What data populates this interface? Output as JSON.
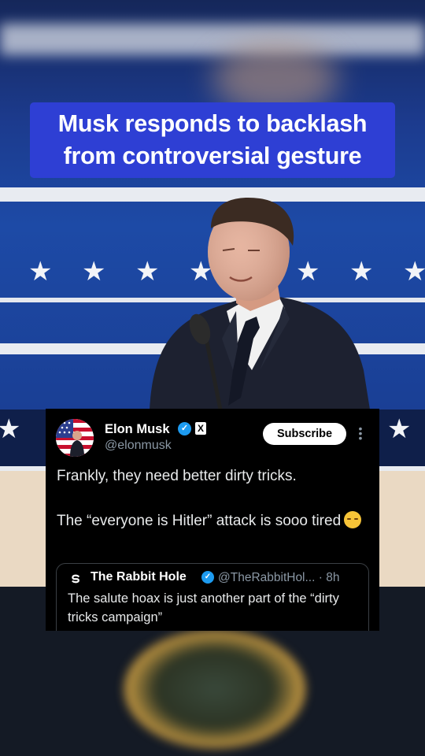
{
  "headline": {
    "line1": "Musk responds to backlash",
    "line2": "from controversial gesture"
  },
  "tweet": {
    "author_name": "Elon Musk",
    "author_handle": "@elonmusk",
    "subscribe_label": "Subscribe",
    "text_line1": "Frankly, they need better dirty tricks.",
    "text_line2": "The “everyone is Hitler” attack is sooo tired",
    "quoted": {
      "author_name": "The Rabbit Hole",
      "author_handle": "@TheRabbitHol...",
      "time": "· 8h",
      "text": "The salute hoax is just another part of the “dirty tricks campaign”"
    }
  },
  "colors": {
    "headline_bg": "#2e3fd4",
    "verified_blue": "#1d9bf0",
    "tweet_bg": "#000000"
  }
}
